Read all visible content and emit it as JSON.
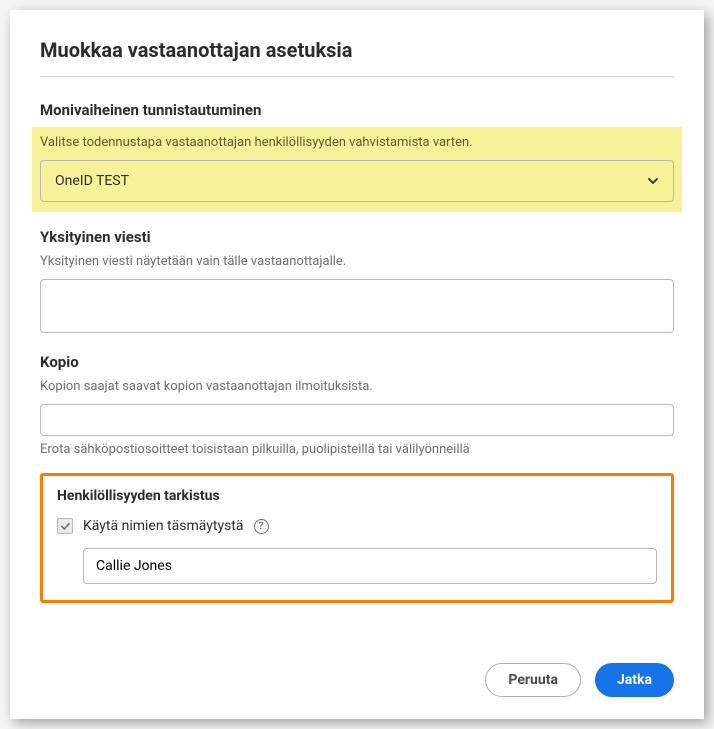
{
  "dialog": {
    "title": "Muokkaa vastaanottajan asetuksia"
  },
  "mfa": {
    "heading": "Monivaiheinen tunnistautuminen",
    "hint": "Valitse todennustapa vastaanottajan henkilöllisyyden vahvistamista varten.",
    "selected": "OneID TEST"
  },
  "privateMessage": {
    "heading": "Yksityinen viesti",
    "hint": "Yksityinen viesti näytetään vain tälle vastaanottajalle.",
    "value": ""
  },
  "copy": {
    "heading": "Kopio",
    "hint": "Kopion saajat saavat kopion vastaanottajan ilmoituksista.",
    "value": "",
    "hintBelow": "Erota sähköpostiosoitteet toisistaan pilkuilla, puolipisteillä tai välilyönneillä"
  },
  "identity": {
    "heading": "Henkilöllisyyden tarkistus",
    "checkboxLabel": "Käytä nimien täsmäytystä",
    "nameValue": "Callie Jones"
  },
  "buttons": {
    "cancel": "Peruuta",
    "continue": "Jatka"
  }
}
